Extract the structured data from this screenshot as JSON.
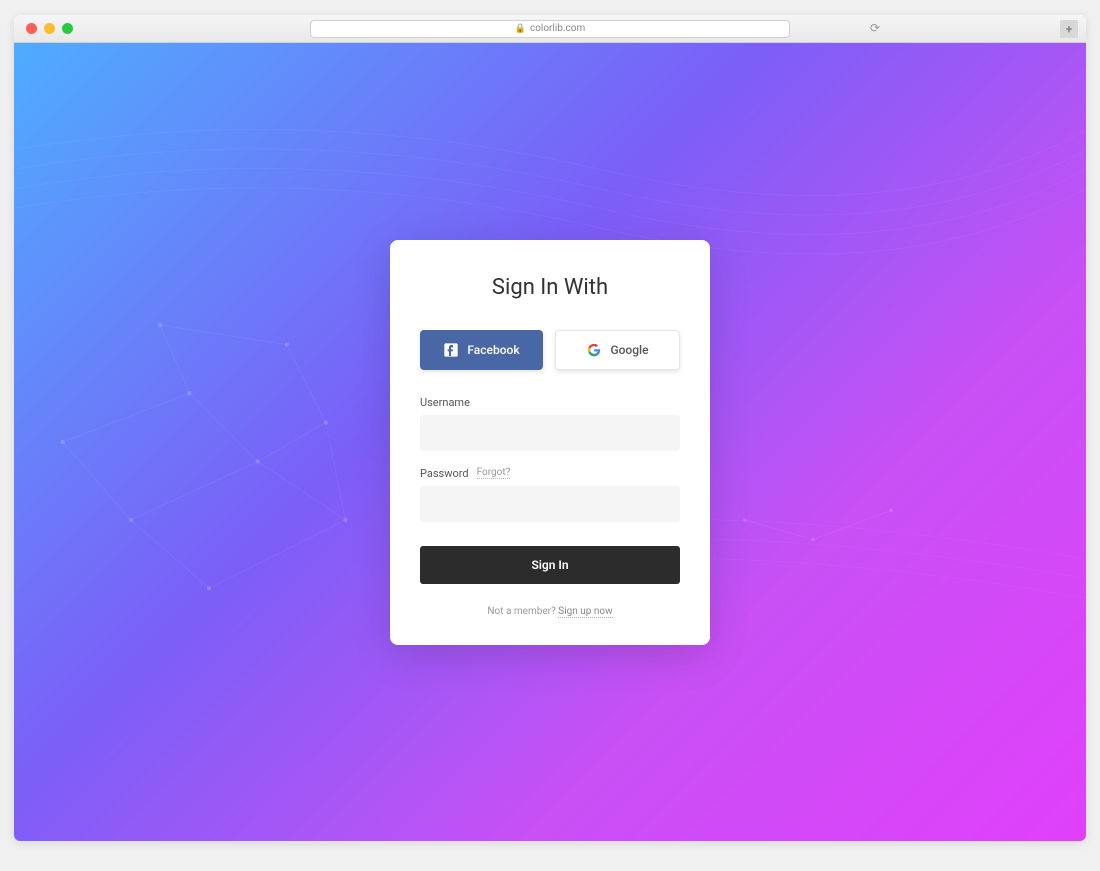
{
  "browser": {
    "url": "colorlib.com"
  },
  "card": {
    "title": "Sign In With",
    "social": {
      "facebook_label": "Facebook",
      "google_label": "Google"
    },
    "form": {
      "username_label": "Username",
      "password_label": "Password",
      "forgot_label": "Forgot?",
      "signin_label": "Sign In"
    },
    "footer": {
      "not_member": "Not a member? ",
      "signup_label": "Sign up now"
    }
  }
}
